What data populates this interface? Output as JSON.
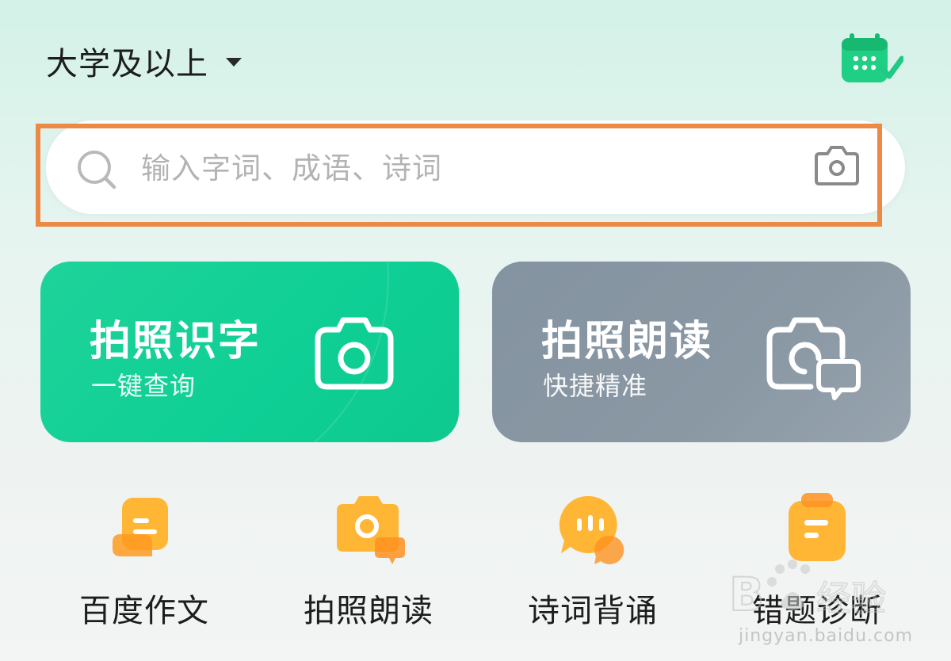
{
  "header": {
    "grade": "大学及以上",
    "calendar_icon": "calendar-check-icon"
  },
  "search": {
    "placeholder": "输入字词、成语、诗词",
    "search_icon": "search-icon",
    "camera_icon": "camera-icon",
    "highlight_color": "#ec8a45"
  },
  "cards": [
    {
      "title": "拍照识字",
      "subtitle": "一键查询",
      "icon": "camera-icon",
      "color": "#12d096"
    },
    {
      "title": "拍照朗读",
      "subtitle": "快捷精准",
      "icon": "camera-speech-icon",
      "color": "#8795a2"
    }
  ],
  "features": [
    {
      "label": "百度作文",
      "icon": "essay-icon"
    },
    {
      "label": "拍照朗读",
      "icon": "photo-read-icon"
    },
    {
      "label": "诗词背诵",
      "icon": "poetry-chat-icon"
    },
    {
      "label": "错题诊断",
      "icon": "mistake-clipboard-icon"
    }
  ],
  "watermark": {
    "url": "jingyan.baidu.com"
  },
  "colors": {
    "accent_orange": "#ffb02e",
    "brand_green": "#12d096"
  }
}
